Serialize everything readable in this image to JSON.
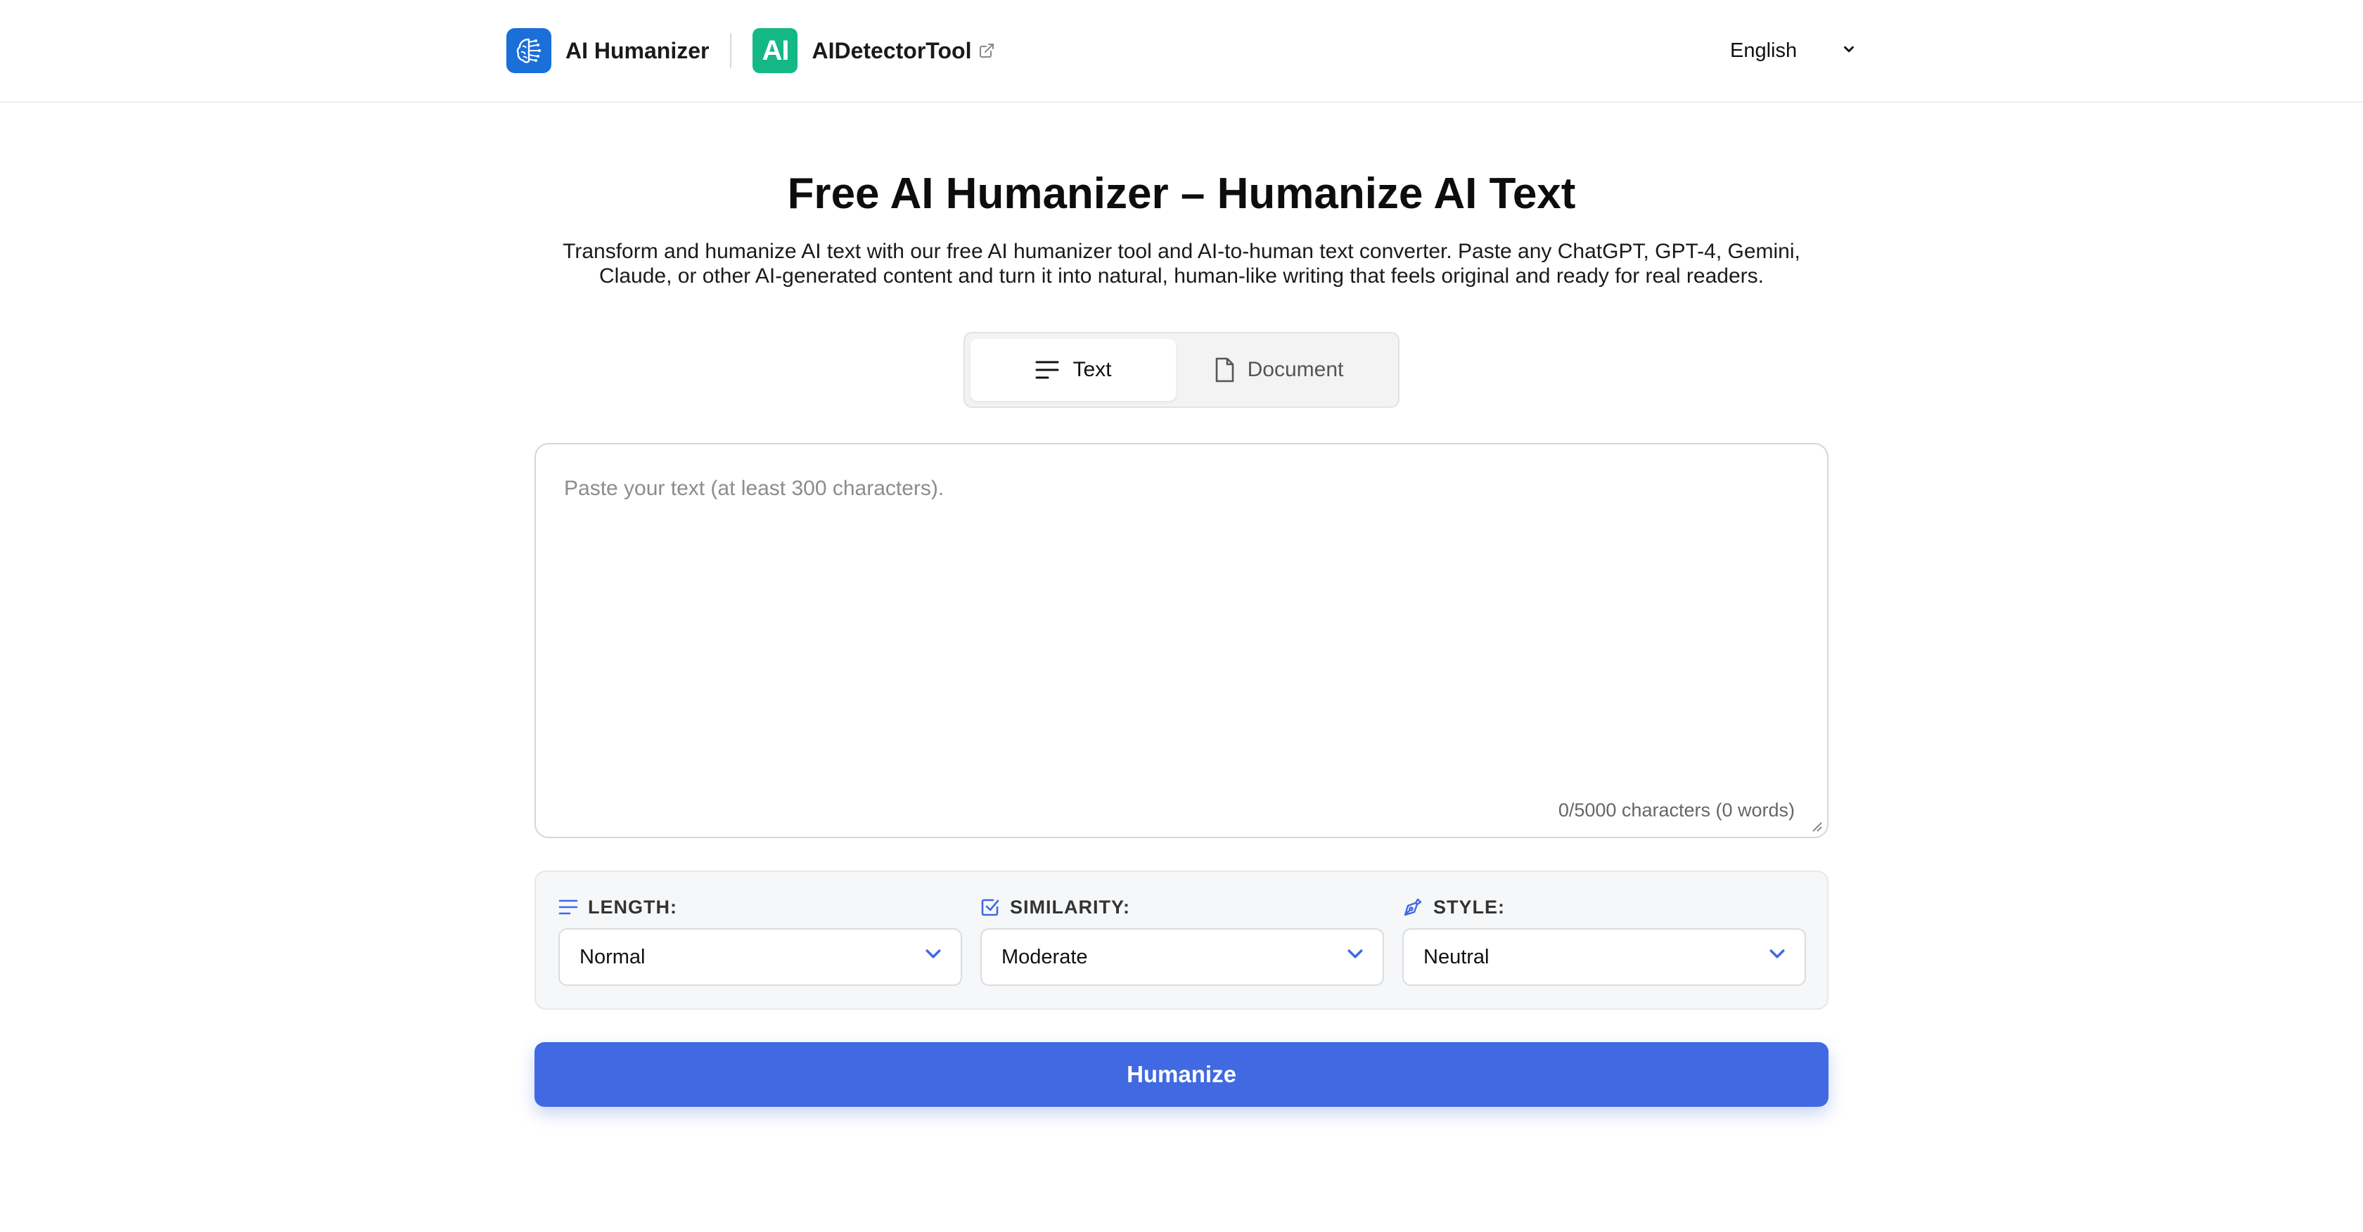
{
  "header": {
    "brand_name": "AI Humanizer",
    "partner_logo_text": "AI",
    "partner_name": "AIDetectorTool",
    "language": "English"
  },
  "hero": {
    "title": "Free AI Humanizer – Humanize AI Text",
    "subtitle": "Transform and humanize AI text with our free AI humanizer tool and AI-to-human text converter. Paste any ChatGPT, GPT-4, Gemini, Claude, or other AI-generated content and turn it into natural, human-like writing that feels original and ready for real readers."
  },
  "tabs": [
    {
      "label": "Text",
      "icon": "lines-icon",
      "active": true
    },
    {
      "label": "Document",
      "icon": "document-icon",
      "active": false
    }
  ],
  "editor": {
    "value": "",
    "placeholder": "Paste your text (at least 300 characters).",
    "char_count": "0/5000 characters (0 words)"
  },
  "options": {
    "length": {
      "label": "LENGTH:",
      "value": "Normal",
      "icon": "lines-icon"
    },
    "similarity": {
      "label": "SIMILARITY:",
      "value": "Moderate",
      "icon": "checkbox-icon"
    },
    "style": {
      "label": "STYLE:",
      "value": "Neutral",
      "icon": "pen-icon"
    }
  },
  "cta": {
    "label": "Humanize"
  },
  "colors": {
    "primary": "#4169e1",
    "brand_logo": "#1a6fd8",
    "partner_logo": "#14b885"
  }
}
